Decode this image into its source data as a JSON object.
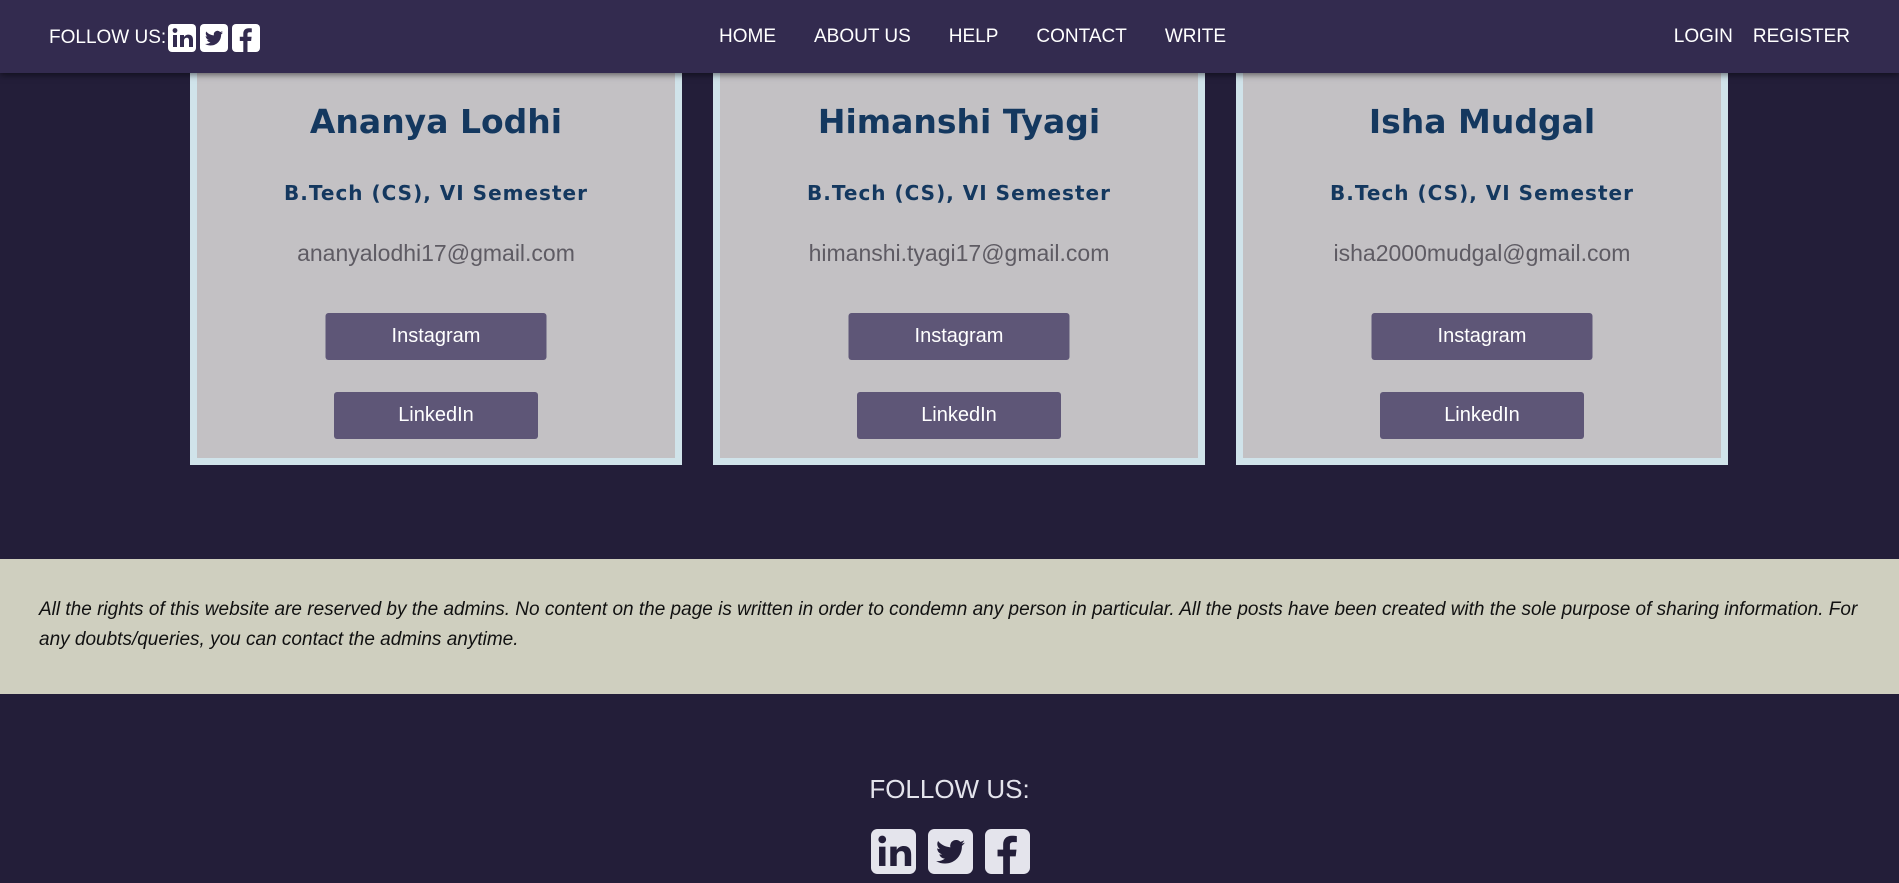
{
  "navbar": {
    "follow_label": "FOLLOW US:",
    "social_icons": [
      "linkedin-icon",
      "twitter-icon",
      "facebook-icon"
    ],
    "links": [
      "HOME",
      "ABOUT US",
      "HELP",
      "CONTACT",
      "WRITE"
    ],
    "login": "LOGIN",
    "register": "REGISTER"
  },
  "cards": [
    {
      "name": "Ananya Lodhi",
      "course": "B.Tech (CS), VI Semester",
      "email": "ananyalodhi17@gmail.com",
      "instagram": "Instagram",
      "linkedin": "LinkedIn"
    },
    {
      "name": "Himanshi Tyagi",
      "course": "B.Tech (CS), VI Semester",
      "email": "himanshi.tyagi17@gmail.com",
      "instagram": "Instagram",
      "linkedin": "LinkedIn"
    },
    {
      "name": "Isha Mudgal",
      "course": "B.Tech (CS), VI Semester",
      "email": "isha2000mudgal@gmail.com",
      "instagram": "Instagram",
      "linkedin": "LinkedIn"
    }
  ],
  "disclaimer": "All the rights of this website are reserved by the admins. No content on the page is written in order to condemn any person in particular. All the posts have been created with the sole purpose of sharing information. For any doubts/queries, you can contact the admins anytime.",
  "footer": {
    "follow_label": "FOLLOW US:",
    "social_icons": [
      "linkedin-icon",
      "twitter-icon",
      "facebook-icon"
    ]
  },
  "colors": {
    "page_background": "#231e39",
    "navbar_background": "#332b4f",
    "card_background": "#c3c1c4",
    "card_border": "#d0e3ea",
    "heading_text": "#14385f",
    "button_background": "#5e5677",
    "disclaimer_background": "#cfcfbf"
  }
}
